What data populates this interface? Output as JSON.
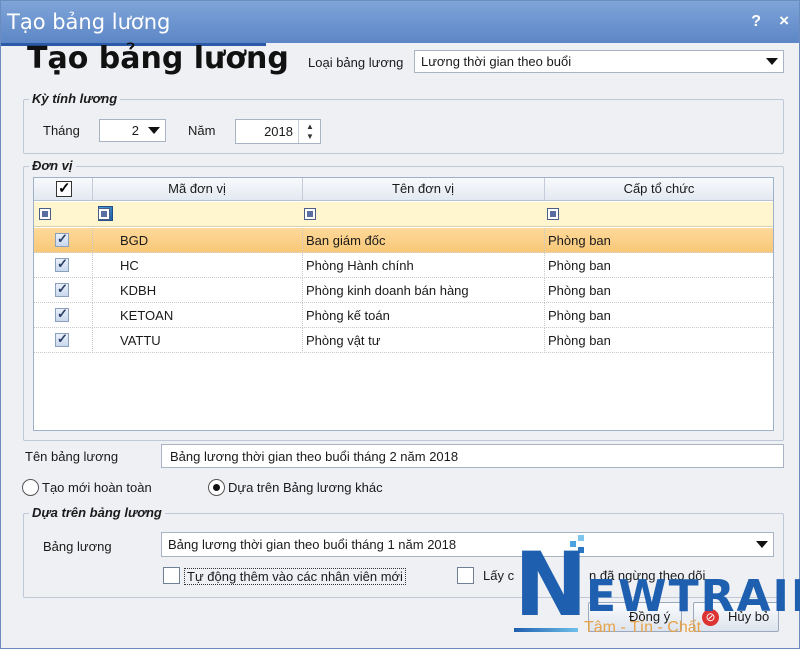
{
  "window": {
    "title": "Tạo bảng lương",
    "help_label": "?",
    "close_label": "×"
  },
  "heading": "Tạo bảng lương",
  "loai_bang_luong": {
    "label": "Loại bảng lương",
    "value": "Lương thời gian theo buổi"
  },
  "ky_tinh_luong": {
    "title": "Kỳ tính lương",
    "thang_label": "Tháng",
    "thang_value": "2",
    "nam_label": "Năm",
    "nam_value": "2018"
  },
  "don_vi": {
    "title": "Đơn vị",
    "columns": [
      "Mã đơn vị",
      "Tên đơn vị",
      "Cấp tổ chức"
    ],
    "rows": [
      {
        "checked": true,
        "ma": "BGD",
        "ten": "Ban giám đốc",
        "cap": "Phòng ban"
      },
      {
        "checked": true,
        "ma": "HC",
        "ten": "Phòng Hành chính",
        "cap": "Phòng ban"
      },
      {
        "checked": true,
        "ma": "KDBH",
        "ten": "Phòng kinh doanh bán hàng",
        "cap": "Phòng ban"
      },
      {
        "checked": true,
        "ma": "KETOAN",
        "ten": "Phòng kế toán",
        "cap": "Phòng ban"
      },
      {
        "checked": true,
        "ma": "VATTU",
        "ten": "Phòng vật tư",
        "cap": "Phòng ban"
      }
    ]
  },
  "ten_bang_luong": {
    "label": "Tên bảng lương",
    "value": "Bảng lương thời gian theo buổi tháng 2 năm 2018"
  },
  "options": {
    "tao_moi": "Tạo mới hoàn toàn",
    "dua_tren": "Dựa trên Bảng lương khác",
    "selected": "dua_tren"
  },
  "dua_tren_group": {
    "title": "Dựa trên bảng lương",
    "bang_luong_label": "Bảng lương",
    "bang_luong_value": "Bảng lương thời gian theo buổi tháng 1 năm 2018",
    "tu_dong_label": "Tự động thêm vào các nhân viên mới",
    "lay_ca_left": "Lấy c",
    "lay_ca_right": "n đã ngừng theo dõi"
  },
  "buttons": {
    "ok": "Đồng ý",
    "cancel": "Hủy bỏ"
  },
  "watermark": {
    "n": "N",
    "rest": "EWTRAIN",
    "slogan": "Tâm - Tín - Chất"
  },
  "colors": {
    "titlebar": "#5c86c6",
    "selected_row": "#f8c878",
    "filter_row": "#fff6cf",
    "logo_blue": "#1f5fb0",
    "logo_orange": "#e7a34a"
  }
}
